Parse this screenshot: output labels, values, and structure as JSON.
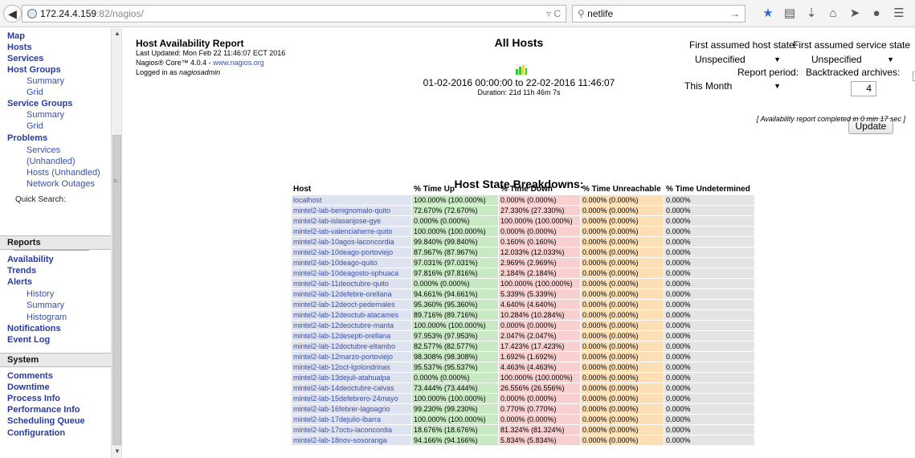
{
  "browser": {
    "url_host": "172.24.4.159",
    "url_rest": ":82/nagios/",
    "search_text": "netlife"
  },
  "sidebar": {
    "map": "Map",
    "hosts": "Hosts",
    "services": "Services",
    "host_groups": "Host Groups",
    "hg_summary": "Summary",
    "hg_grid": "Grid",
    "service_groups": "Service Groups",
    "sg_summary": "Summary",
    "sg_grid": "Grid",
    "problems": "Problems",
    "p_services": "Services",
    "p_unhandled": "(Unhandled)",
    "p_hosts": "Hosts",
    "p_hosts_unhandled": "(Unhandled)",
    "p_network": "Network Outages",
    "quick_search": "Quick Search:",
    "reports": "Reports",
    "availability": "Availability",
    "trends": "Trends",
    "alerts": "Alerts",
    "history": "History",
    "a_summary": "Summary",
    "histogram": "Histogram",
    "notifications": "Notifications",
    "event_log": "Event Log",
    "system": "System",
    "comments": "Comments",
    "downtime": "Downtime",
    "process_info": "Process Info",
    "performance_info": "Performance Info",
    "scheduling_queue": "Scheduling Queue",
    "configuration": "Configuration"
  },
  "header": {
    "report_title": "Host Availability Report",
    "last_updated": "Last Updated: Mon Feb 22 11:46:07 ECT 2016",
    "core_prefix": "Nagios® Core™ 4.0.4 - ",
    "core_link": "www.nagios.org",
    "logged_prefix": "Logged in as ",
    "logged_user": "nagiosadmin",
    "all_hosts": "All Hosts",
    "range": "01-02-2016 00:00:00 to 22-02-2016 11:46:07",
    "duration": "Duration: 21d 11h 46m 7s"
  },
  "controls": {
    "host_state_label": "First assumed host state:",
    "host_state_value": "Unspecified",
    "service_state_label": "First assumed service state",
    "service_state_value": "Unspecified",
    "report_period_label": "Report period:",
    "report_period_value": "This Month",
    "backtracked_label": "Backtracked archives:",
    "backtracked_value": "4",
    "update_label": "Update",
    "completed": "[ Availability report completed in 0 min 17 sec ]"
  },
  "breakdown": {
    "title": "Host State Breakdowns:",
    "columns": [
      "Host",
      "% Time Up",
      "% Time Down",
      "% Time Unreachable",
      "% Time Undetermined"
    ],
    "rows": [
      [
        "localhost",
        "100.000% (100.000%)",
        "0.000% (0.000%)",
        "0.000% (0.000%)",
        "0.000%"
      ],
      [
        "mintel2-lab-benignomalo-quito",
        "72.670% (72.670%)",
        "27.330% (27.330%)",
        "0.000% (0.000%)",
        "0.000%"
      ],
      [
        "mintel2-lab-islasanjose-gye",
        "0.000% (0.000%)",
        "100.000% (100.000%)",
        "0.000% (0.000%)",
        "0.000%"
      ],
      [
        "mintel2-lab-valenciaherre-quito",
        "100.000% (100.000%)",
        "0.000% (0.000%)",
        "0.000% (0.000%)",
        "0.000%"
      ],
      [
        "mintel2-lab-10agos-laconcordia",
        "99.840% (99.840%)",
        "0.160% (0.160%)",
        "0.000% (0.000%)",
        "0.000%"
      ],
      [
        "mintel2-lab-10deago-portoviejo",
        "87.967% (87.967%)",
        "12.033% (12.033%)",
        "0.000% (0.000%)",
        "0.000%"
      ],
      [
        "mintel2-lab-10deago-quito",
        "97.031% (97.031%)",
        "2.969% (2.969%)",
        "0.000% (0.000%)",
        "0.000%"
      ],
      [
        "mintel2-lab-10deagosto-sphuaca",
        "97.816% (97.816%)",
        "2.184% (2.184%)",
        "0.000% (0.000%)",
        "0.000%"
      ],
      [
        "mintel2-lab-11deoctubre-quito",
        "0.000% (0.000%)",
        "100.000% (100.000%)",
        "0.000% (0.000%)",
        "0.000%"
      ],
      [
        "mintel2-lab-12defebre-orellana",
        "94.661% (94.661%)",
        "5.339% (5.339%)",
        "0.000% (0.000%)",
        "0.000%"
      ],
      [
        "mintel2-lab-12deoct-pedernales",
        "95.360% (95.360%)",
        "4.640% (4.640%)",
        "0.000% (0.000%)",
        "0.000%"
      ],
      [
        "mintel2-lab-12deoctub-atacames",
        "89.716% (89.716%)",
        "10.284% (10.284%)",
        "0.000% (0.000%)",
        "0.000%"
      ],
      [
        "mintel2-lab-12deoctubre-manta",
        "100.000% (100.000%)",
        "0.000% (0.000%)",
        "0.000% (0.000%)",
        "0.000%"
      ],
      [
        "mintel2-lab-12desepti-orellana",
        "97.953% (97.953%)",
        "2.047% (2.047%)",
        "0.000% (0.000%)",
        "0.000%"
      ],
      [
        "mintel2-lab-12doctubre-eltambo",
        "82.577% (82.577%)",
        "17.423% (17.423%)",
        "0.000% (0.000%)",
        "0.000%"
      ],
      [
        "mintel2-lab-12marzo-portoviejo",
        "98.308% (98.308%)",
        "1.692% (1.692%)",
        "0.000% (0.000%)",
        "0.000%"
      ],
      [
        "mintel2-lab-12oct-lgolondrinas",
        "95.537% (95.537%)",
        "4.463% (4.463%)",
        "0.000% (0.000%)",
        "0.000%"
      ],
      [
        "mintel2-lab-13dejuli-atahualpa",
        "0.000% (0.000%)",
        "100.000% (100.000%)",
        "0.000% (0.000%)",
        "0.000%"
      ],
      [
        "mintel2-lab-14deoctubre-calvas",
        "73.444% (73.444%)",
        "26.556% (26.556%)",
        "0.000% (0.000%)",
        "0.000%"
      ],
      [
        "mintel2-lab-15defebrero-24mayo",
        "100.000% (100.000%)",
        "0.000% (0.000%)",
        "0.000% (0.000%)",
        "0.000%"
      ],
      [
        "mintel2-lab-16febrer-lagoagrio",
        "99.230% (99.230%)",
        "0.770% (0.770%)",
        "0.000% (0.000%)",
        "0.000%"
      ],
      [
        "mintel2-lab-17dejulio-ibarra",
        "100.000% (100.000%)",
        "0.000% (0.000%)",
        "0.000% (0.000%)",
        "0.000%"
      ],
      [
        "mintel2-lab-17octu-laconcordia",
        "18.676% (18.676%)",
        "81.324% (81.324%)",
        "0.000% (0.000%)",
        "0.000%"
      ],
      [
        "mintel2-lab-18nov-sosoranga",
        "94.166% (94.166%)",
        "5.834% (5.834%)",
        "0.000% (0.000%)",
        "0.000%"
      ]
    ]
  },
  "colors": {
    "host_cell": "#dfe3ef",
    "up_cell": "#c9e9c4",
    "down_cell": "#f9d0d0",
    "unreachable_cell": "#fddfb6",
    "undetermined_cell": "#e4e4e4",
    "link": "#3b4fa6"
  }
}
